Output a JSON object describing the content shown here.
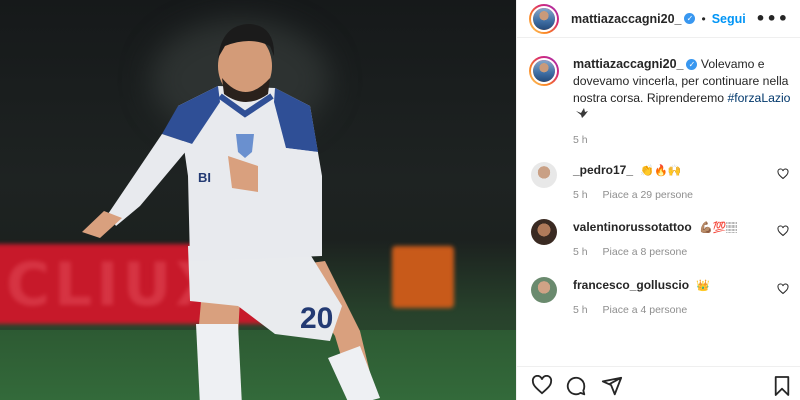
{
  "post": {
    "author": "mattiazaccagni20_",
    "follow_label": "Segui",
    "dot": "•",
    "more_icon": "•••",
    "caption_text": "Volevamo e dovevamo vincerla, per continuare nella nostra corsa. Riprenderemo",
    "caption_hashtag": "#forzaLazio",
    "caption_emoji": "eagle",
    "caption_time": "5 h"
  },
  "photo": {
    "jersey_number": "20",
    "sponsor": "BI",
    "board_text": "CLIUX"
  },
  "comments": [
    {
      "user": "_pedro17_",
      "text": "👏🔥🙌",
      "time": "5 h",
      "likes": "Piace a 29 persone"
    },
    {
      "user": "valentinorussotattoo",
      "text": "💪🏽💯🏽",
      "time": "5 h",
      "likes": "Piace a 8 persone"
    },
    {
      "user": "francesco_golluscio",
      "text": "👑",
      "time": "5 h",
      "likes": "Piace a 4 persone"
    }
  ],
  "colors": {
    "follow": "#0095f6",
    "verified": "#3897f0",
    "hashtag": "#00376b",
    "meta": "#8e8e8e"
  },
  "icons": [
    "heart-icon",
    "comment-icon",
    "share-icon",
    "bookmark-icon",
    "verified-icon",
    "more-icon"
  ]
}
